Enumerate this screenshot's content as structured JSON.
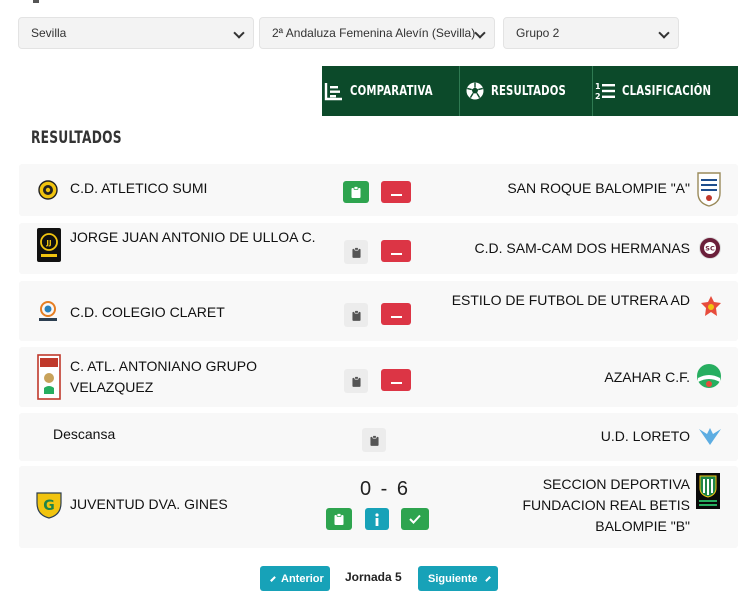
{
  "filters": {
    "region": "Sevilla",
    "competition": "2ª Andaluza Femenina Alevín (Sevilla)",
    "group": "Grupo 2"
  },
  "tabs": [
    {
      "label": "COMPARATIVA",
      "icon": "chart-list-icon"
    },
    {
      "label": "RESULTADOS",
      "icon": "soccer-ball-icon"
    },
    {
      "label": "CLASIFICACIÓN",
      "icon": "ordered-list-icon"
    }
  ],
  "section_title": "RESULTADOS",
  "matches": [
    {
      "home": "C.D. ATLETICO SUMI",
      "away": "SAN ROQUE BALOMPIE \"A\""
    },
    {
      "home": "JORGE JUAN ANTONIO DE ULLOA C.",
      "away": "C.D. SAM-CAM DOS HERMANAS"
    },
    {
      "home": "C.D. COLEGIO CLARET",
      "away": "ESTILO DE FUTBOL DE UTRERA AD"
    },
    {
      "home": "C. ATL. ANTONIANO GRUPO VELAZQUEZ",
      "away": "AZAHAR C.F."
    },
    {
      "home": "Descansa",
      "away": "U.D. LORETO"
    },
    {
      "home": "JUVENTUD DVA. GINES",
      "away": "SECCION DEPORTIVA FUNDACION REAL BETIS BALOMPIE \"B\"",
      "score": "0 - 6"
    }
  ],
  "pager": {
    "prev_label": "Anterior",
    "current": "Jornada 5",
    "next_label": "Siguiente"
  },
  "colors": {
    "tab_bg": "#0c4a2a",
    "green": "#2ea44f",
    "red": "#dc3545",
    "teal": "#17a2b8"
  }
}
